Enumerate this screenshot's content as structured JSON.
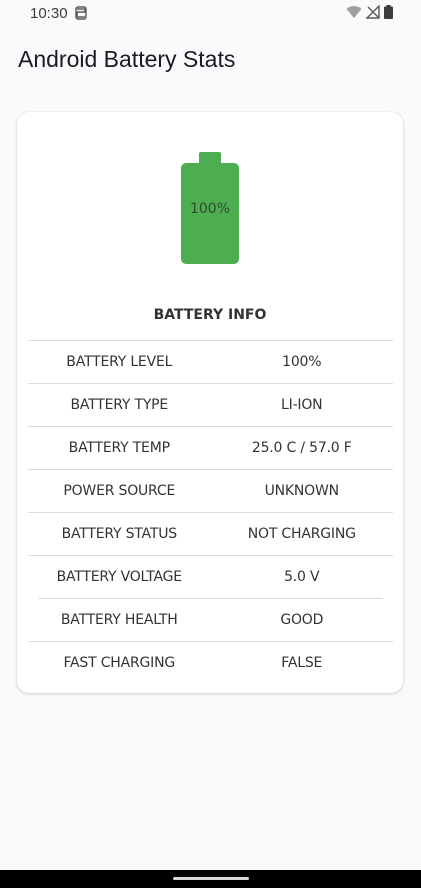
{
  "status_bar": {
    "time": "10:30",
    "notification_icon": "sync-notification-icon",
    "wifi_icon": "wifi-icon",
    "signal_icon": "signal-off-icon",
    "battery_icon": "battery-full-icon"
  },
  "app": {
    "title": "Android Battery Stats"
  },
  "battery_graphic": {
    "label": "100%",
    "level_percent": 100,
    "color": "#4cae50"
  },
  "info": {
    "heading": "BATTERY INFO",
    "rows": [
      {
        "label": "BATTERY LEVEL",
        "value": "100%"
      },
      {
        "label": "BATTERY TYPE",
        "value": "LI-ION"
      },
      {
        "label": "BATTERY TEMP",
        "value": "25.0 C / 57.0 F"
      },
      {
        "label": "POWER SOURCE",
        "value": "UNKNOWN"
      },
      {
        "label": "BATTERY STATUS",
        "value": "NOT CHARGING"
      },
      {
        "label": "BATTERY VOLTAGE",
        "value": "5.0 V"
      },
      {
        "label": "BATTERY HEALTH",
        "value": "GOOD"
      },
      {
        "label": "FAST CHARGING",
        "value": "FALSE"
      }
    ]
  },
  "colors": {
    "background": "#fcf9fd",
    "card": "#ffffff",
    "battery_green": "#4cae50",
    "divider": "#dcdcdc",
    "nav_bar": "#000000"
  }
}
